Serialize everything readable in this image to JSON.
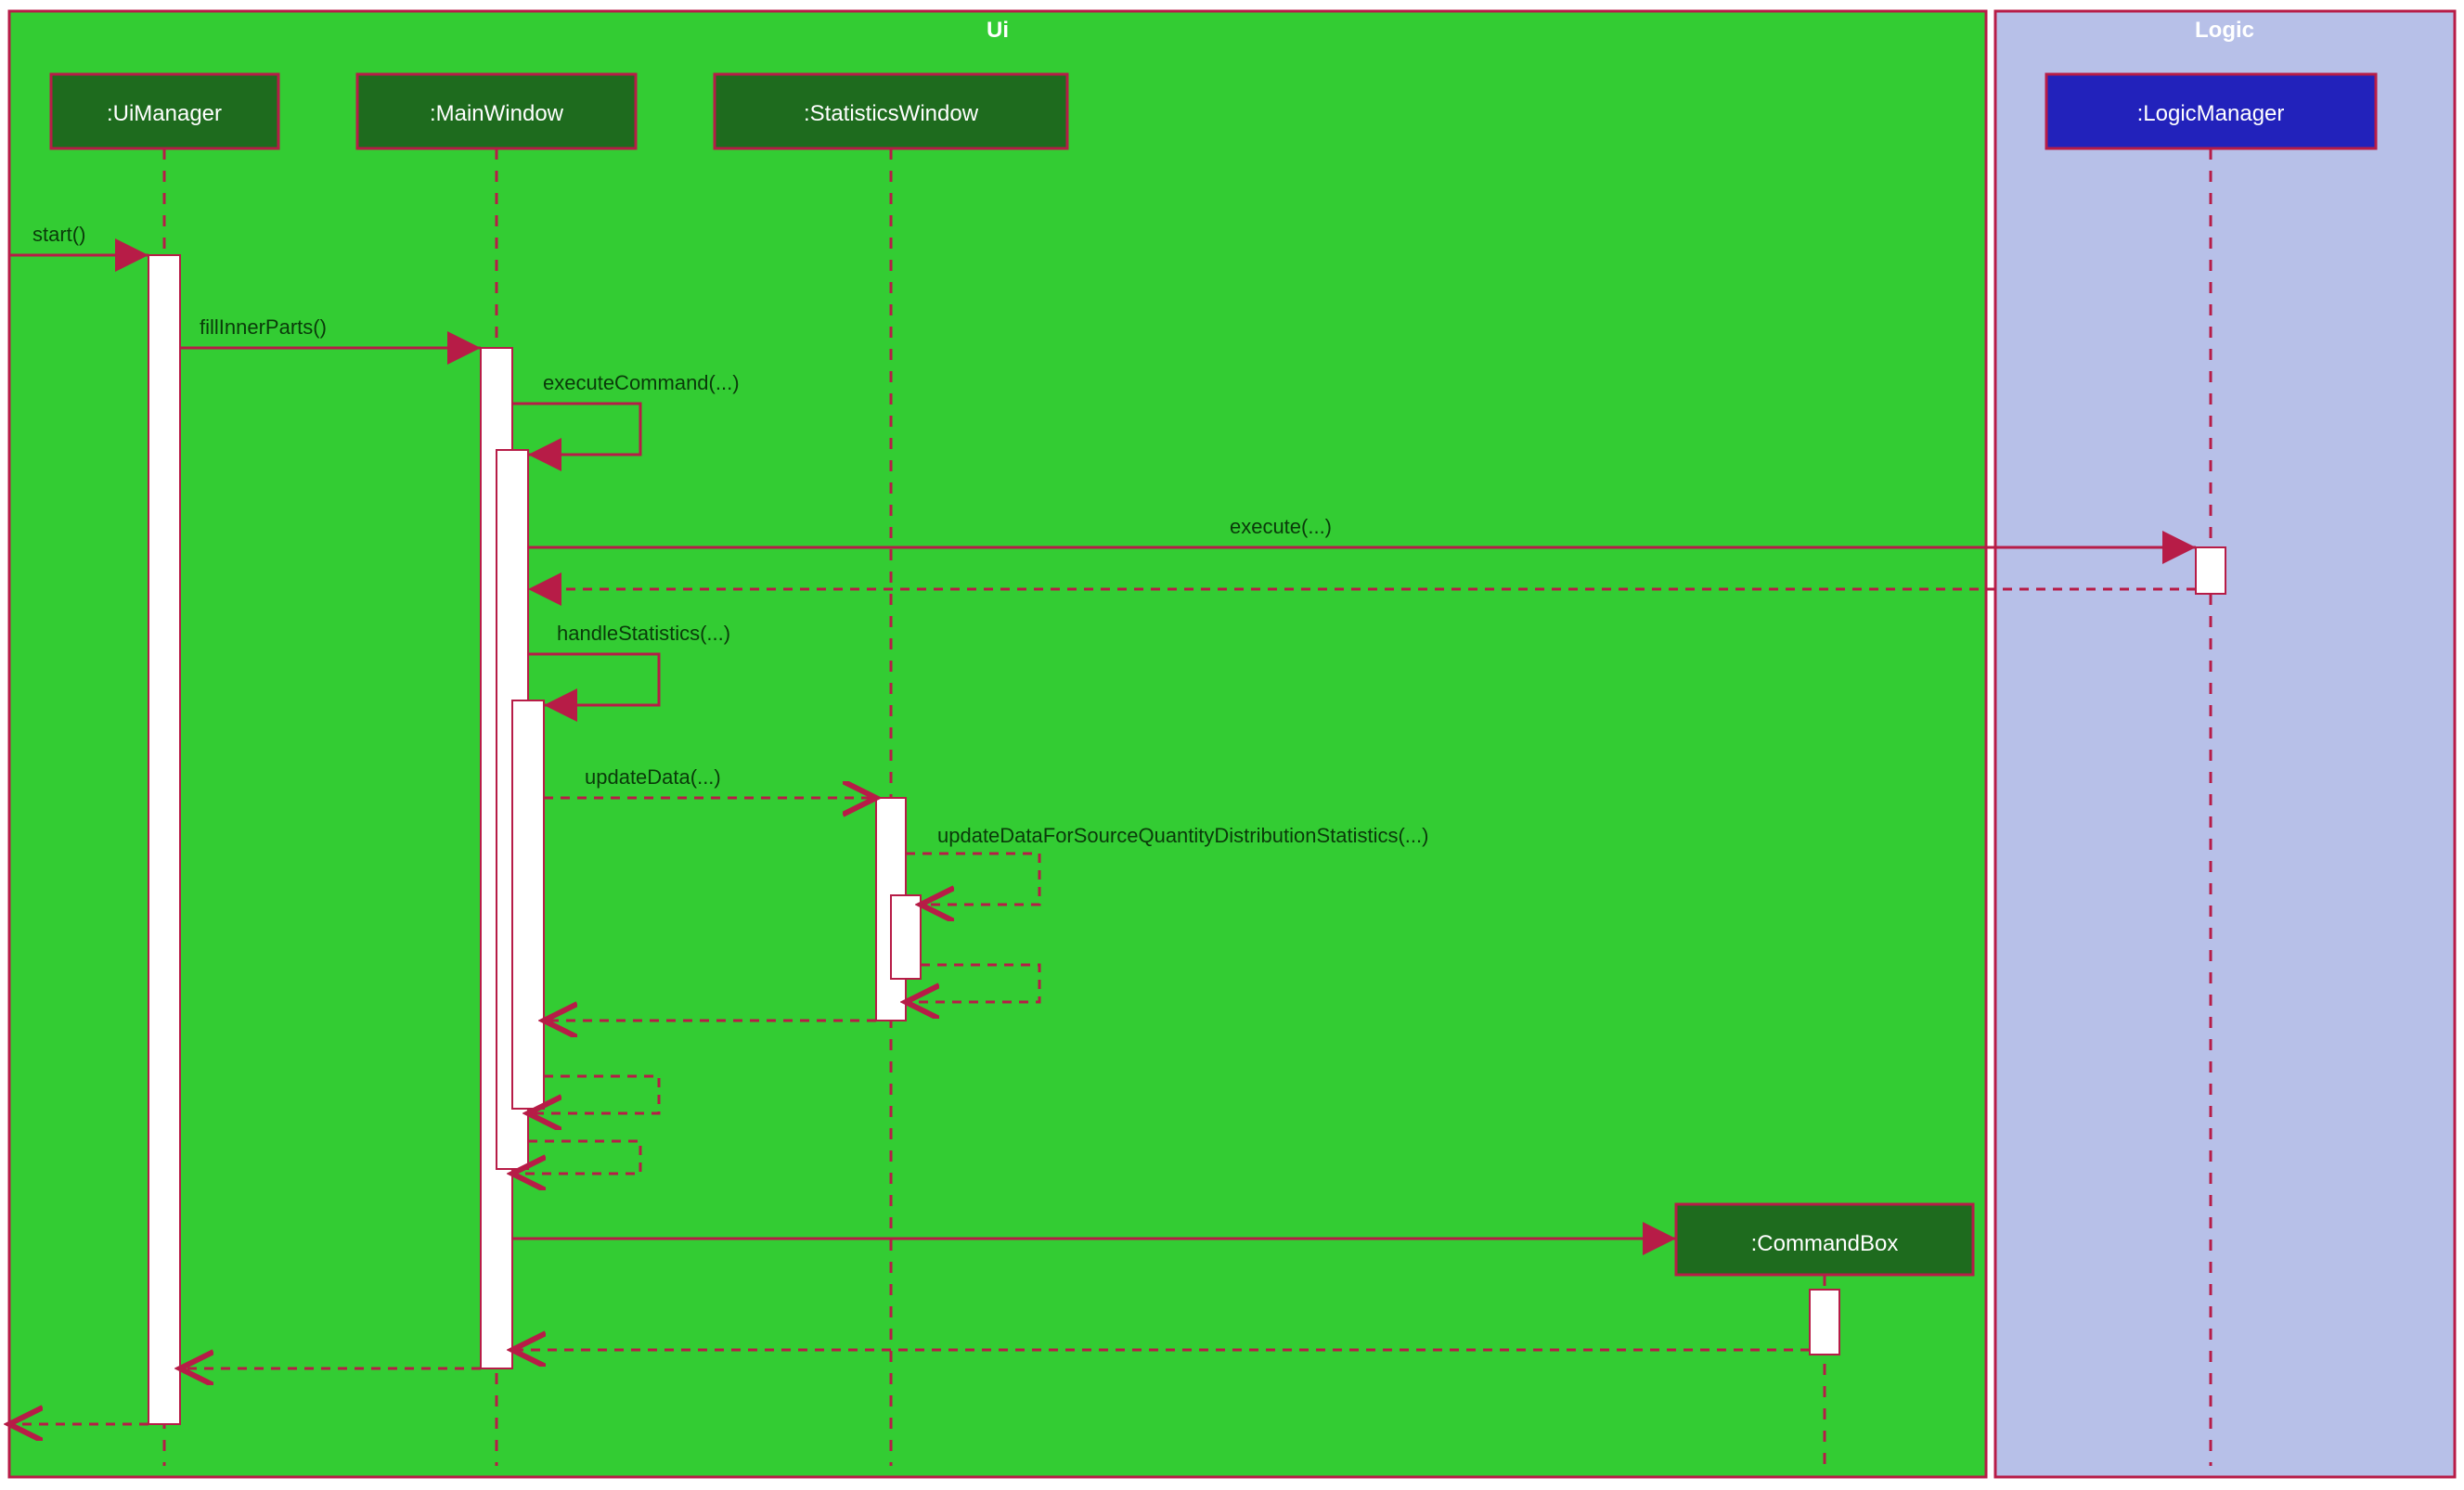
{
  "frames": {
    "ui": {
      "title": "Ui",
      "fill": "#33CC33"
    },
    "logic": {
      "title": "Logic",
      "fill": "#B7C0E8"
    }
  },
  "lifelines": {
    "uiManager": ":UiManager",
    "mainWindow": ":MainWindow",
    "statisticsWindow": ":StatisticsWindow",
    "logicManager": ":LogicManager",
    "commandBox": ":CommandBox"
  },
  "messages": {
    "start": "start()",
    "fillInnerParts": "fillInnerParts()",
    "executeCommand": "executeCommand(...)",
    "execute": "execute(...)",
    "handleStatistics": "handleStatistics(...)",
    "updateData": "updateData(...)",
    "updateDataForSrc": "updateDataForSourceQuantityDistributionStatistics(...)"
  },
  "colors": {
    "line": "#B71C47",
    "uiHead": "#1E6B1E",
    "logicHead": "#2222BB",
    "activation": "#FFFFFF"
  }
}
